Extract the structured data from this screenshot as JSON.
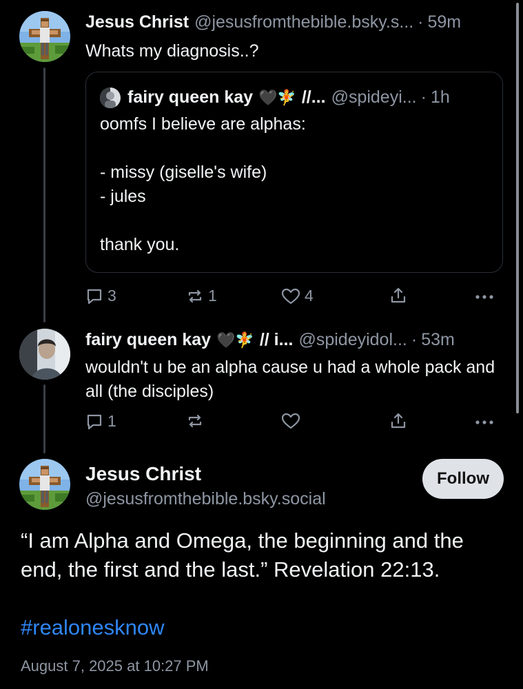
{
  "post1": {
    "author_name": "Jesus Christ",
    "handle": "@jesusfromthebible.bsky.s...",
    "dot": "·",
    "time": "59m",
    "text": "Whats my diagnosis..?",
    "avatar_icon": "jesus-pixel-avatar",
    "quote": {
      "author_name": "fairy queen kay",
      "emoji": "🖤🧚",
      "name_suffix": "//...",
      "handle": "@spideyi...",
      "dot": "·",
      "time": "1h",
      "text": "oomfs I believe are alphas:\n\n- missy (giselle's wife)\n- jules\n\nthank you."
    },
    "actions": {
      "reply_count": "3",
      "repost_count": "1",
      "like_count": "4"
    }
  },
  "post2": {
    "author_name": "fairy queen kay",
    "emoji": "🖤🧚",
    "name_suffix": "// i...",
    "handle": "@spideyidol...",
    "dot": "·",
    "time": "53m",
    "text": "wouldn't u be an alpha cause u had a whole pack and all (the disciples)",
    "actions": {
      "reply_count": "1",
      "repost_count": "",
      "like_count": ""
    }
  },
  "main_post": {
    "author_name": "Jesus Christ",
    "handle": "@jesusfromthebible.bsky.social",
    "follow_label": "Follow",
    "text": "“I am Alpha and Omega, the beginning and the end, the first and the last.” Revelation 22:13.",
    "hashtag": "#realonesknow",
    "date": "August 7, 2025 at 10:27 PM"
  },
  "colors": {
    "background": "#000000",
    "text": "#f1f3f5",
    "muted": "#8e96a3",
    "link": "#2f86f7",
    "follow_bg": "#dfe3e8"
  }
}
